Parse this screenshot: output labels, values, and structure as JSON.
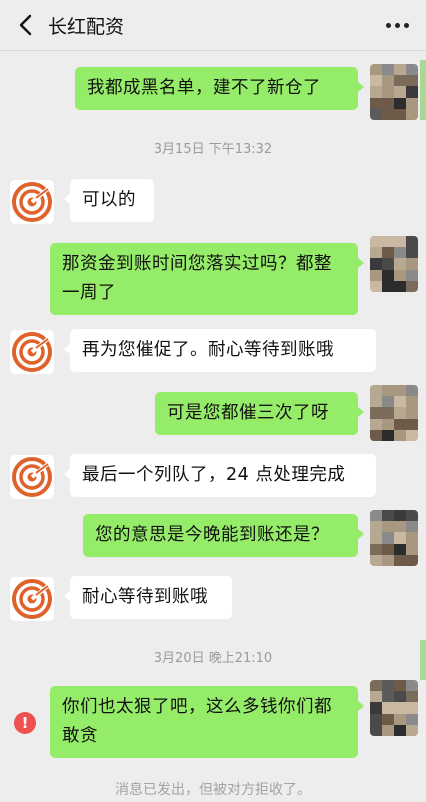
{
  "header": {
    "title": "长红配资",
    "back_icon": "chevron-left-icon",
    "more_icon": "more-dots-icon"
  },
  "messages": [
    {
      "side": "me",
      "text": "我都成黑名单，建不了新仓了"
    },
    {
      "type": "time",
      "text": "3月15日 下午13:32"
    },
    {
      "side": "other",
      "text": "可以的"
    },
    {
      "side": "me",
      "text": "那资金到账时间您落实过吗？都整一周了"
    },
    {
      "side": "other",
      "text": "再为您催促了。耐心等待到账哦"
    },
    {
      "side": "me",
      "text": "可是您都催三次了呀"
    },
    {
      "side": "other",
      "text": "最后一个列队了，24 点处理完成"
    },
    {
      "side": "me",
      "text": "您的意思是今晚能到账还是？"
    },
    {
      "side": "other",
      "text": "耐心等待到账哦"
    },
    {
      "type": "time",
      "text": "3月20日 晚上21:10"
    },
    {
      "side": "me",
      "text": "你们也太狠了吧，这么多钱你们都敢贪",
      "failed": true
    },
    {
      "type": "system",
      "text": "消息已发出，但被对方拒收了。"
    }
  ],
  "error_icon_text": "!",
  "colors": {
    "me_bubble": "#95ec69",
    "other_bubble": "#ffffff",
    "background": "#ededed",
    "error": "#f15050",
    "logo_orange": "#e0622b"
  }
}
